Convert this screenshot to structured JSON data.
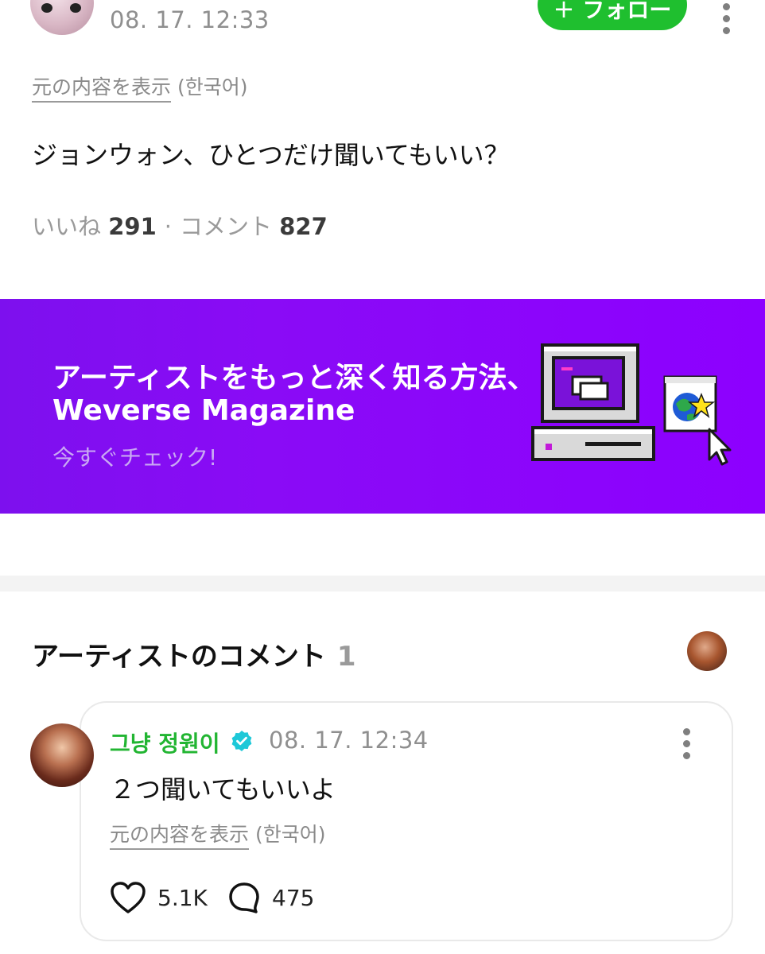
{
  "post": {
    "time": "08. 17. 12:33",
    "follow_label": "フォロー",
    "translate_link": "元の内容を表示",
    "translate_lang": "(한국어)",
    "text": "ジョンウォン、ひとつだけ聞いてもいい？",
    "likes_label": "いいね",
    "likes_count": "291",
    "separator": "·",
    "comments_label": "コメント",
    "comments_count": "827"
  },
  "banner": {
    "title": "アーティストをもっと深く知る方法、",
    "subtitle": "Weverse Magazine",
    "cta": "今すぐチェック!"
  },
  "artist_comments": {
    "heading": "アーティストのコメント",
    "count": "1",
    "comment": {
      "author": "그냥 정원이",
      "time": "08. 17. 12:34",
      "text": "２つ聞いてもいいよ",
      "translate_link": "元の内容を表示",
      "translate_lang": "(한국어)",
      "likes": "5.1K",
      "replies": "475"
    }
  },
  "colors": {
    "accent_green": "#1fbf2f",
    "author_green": "#22b532",
    "banner_purple": "#8d00ff",
    "verified_teal": "#1ec8d8"
  },
  "icons": [
    "plus-icon",
    "more-vert-icon",
    "verified-badge-icon",
    "heart-icon",
    "speech-bubble-icon",
    "retro-computer-illustration",
    "globe-star-card-icon",
    "cursor-arrow-icon"
  ]
}
